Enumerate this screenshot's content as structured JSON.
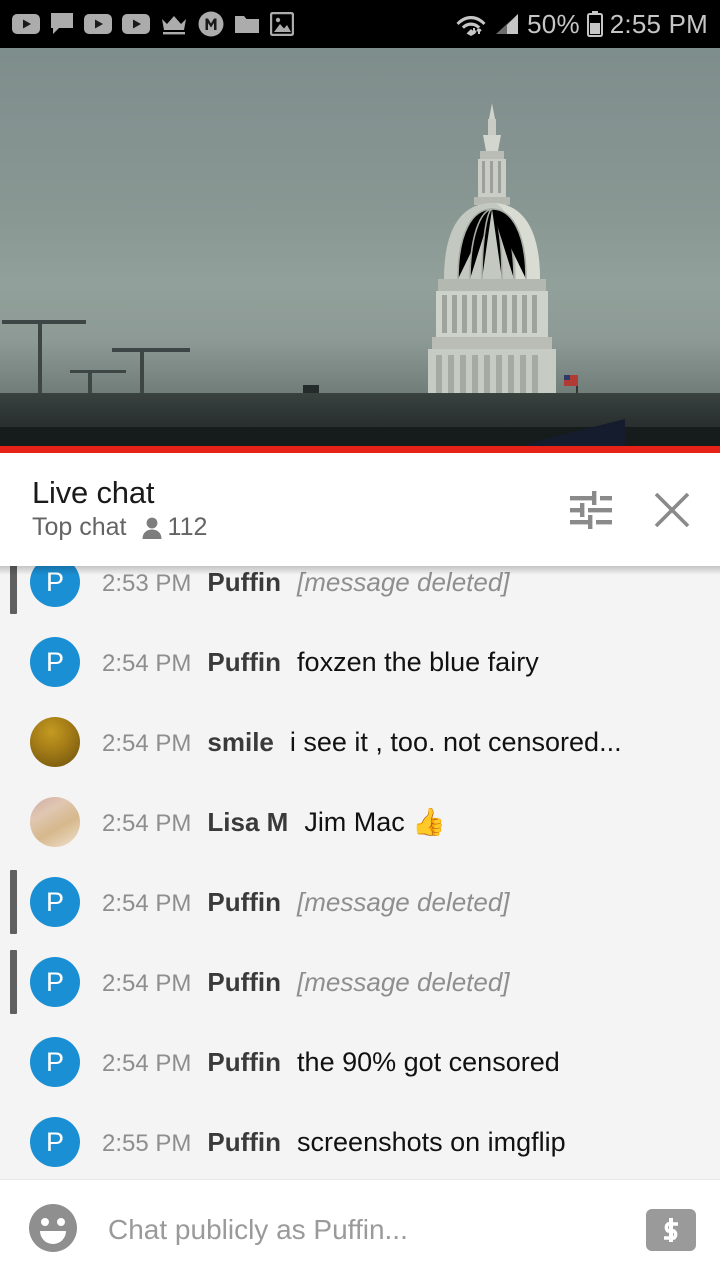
{
  "status_bar": {
    "notification_icons": [
      "youtube-play-icon",
      "chat-bubble-icon",
      "youtube-play-icon",
      "youtube-play-icon",
      "crown-icon",
      "m-circle-icon",
      "folder-icon",
      "image-icon"
    ],
    "wifi_icon": "wifi-icon",
    "signal_icon": "cell-signal-icon",
    "battery_percent": "50%",
    "battery_icon": "battery-icon",
    "time": "2:55 PM"
  },
  "video": {
    "name": "us-capitol-live-stream",
    "progress_color": "#e62117",
    "progress_percent": 100
  },
  "chat_header": {
    "title": "Live chat",
    "mode": "Top chat",
    "viewer_icon": "person-icon",
    "viewer_count": "112",
    "tune_icon": "tune-sliders-icon",
    "close_icon": "close-icon"
  },
  "messages": [
    {
      "time": "2:53 PM",
      "author": "Puffin",
      "text": "[message deleted]",
      "deleted": true,
      "avatar_type": "initial",
      "avatar_initial": "P",
      "avatar_color": "#1b8fd3",
      "clipped": true
    },
    {
      "time": "2:54 PM",
      "author": "Puffin",
      "text": "foxzen the blue fairy",
      "deleted": false,
      "avatar_type": "initial",
      "avatar_initial": "P",
      "avatar_color": "#1b8fd3"
    },
    {
      "time": "2:54 PM",
      "author": "smile",
      "text": "i see it , too. not censored...",
      "deleted": false,
      "avatar_type": "photo-smile",
      "avatar_initial": "",
      "avatar_color": "#a67d17"
    },
    {
      "time": "2:54 PM",
      "author": "Lisa M",
      "text": "Jim Mac 👍",
      "deleted": false,
      "avatar_type": "photo-lisa",
      "avatar_initial": "",
      "avatar_color": "#d6b88c"
    },
    {
      "time": "2:54 PM",
      "author": "Puffin",
      "text": "[message deleted]",
      "deleted": true,
      "avatar_type": "initial",
      "avatar_initial": "P",
      "avatar_color": "#1b8fd3"
    },
    {
      "time": "2:54 PM",
      "author": "Puffin",
      "text": "[message deleted]",
      "deleted": true,
      "avatar_type": "initial",
      "avatar_initial": "P",
      "avatar_color": "#1b8fd3"
    },
    {
      "time": "2:54 PM",
      "author": "Puffin",
      "text": "the 90% got censored",
      "deleted": false,
      "avatar_type": "initial",
      "avatar_initial": "P",
      "avatar_color": "#1b8fd3"
    },
    {
      "time": "2:55 PM",
      "author": "Puffin",
      "text": "screenshots on imgflip",
      "deleted": false,
      "avatar_type": "initial",
      "avatar_initial": "P",
      "avatar_color": "#1b8fd3"
    }
  ],
  "input_bar": {
    "emoji_icon": "emoji-smiley-icon",
    "placeholder": "Chat publicly as Puffin...",
    "value": "",
    "superchat_icon": "dollar-superchat-icon"
  }
}
